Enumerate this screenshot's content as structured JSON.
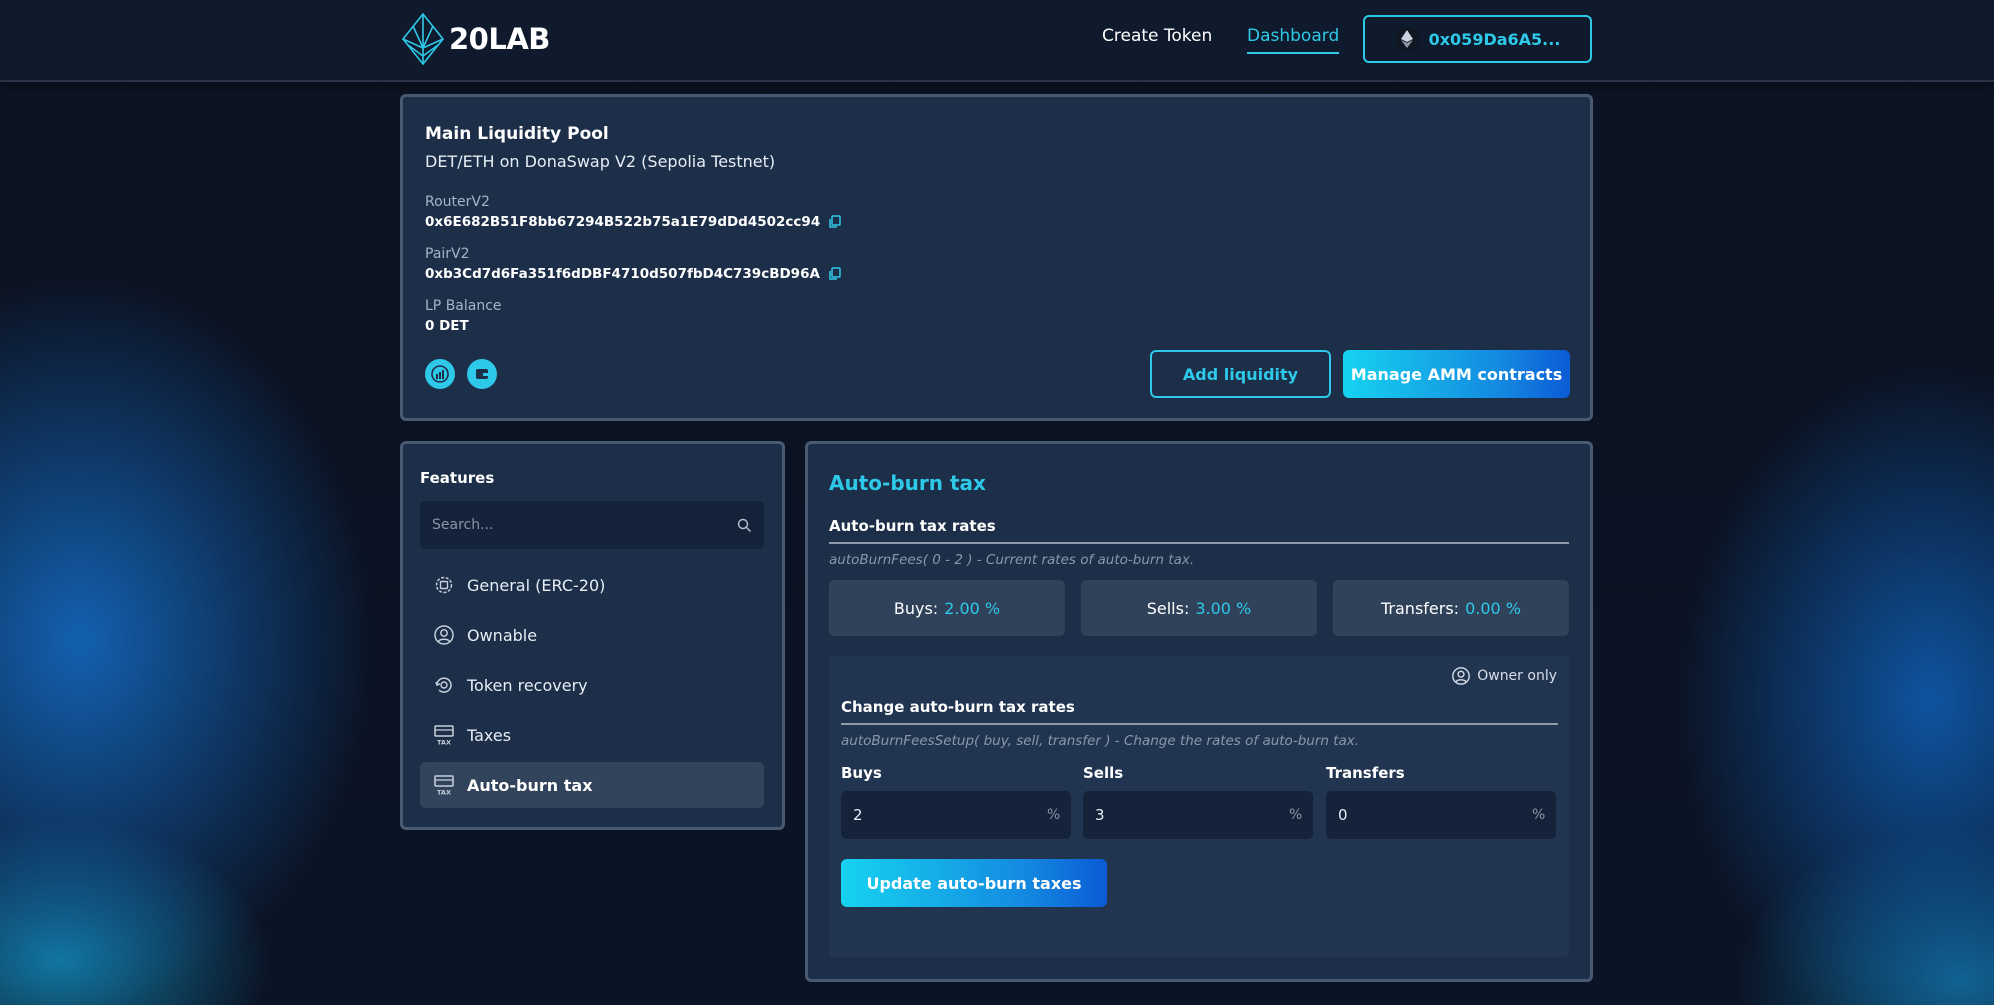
{
  "header": {
    "logo_text": "20LAB",
    "nav": {
      "create_token": "Create Token",
      "dashboard": "Dashboard"
    },
    "wallet_address": "0x059Da6A5..."
  },
  "pool": {
    "title": "Main Liquidity Pool",
    "subtitle": "DET/ETH on DonaSwap V2 (Sepolia Testnet)",
    "router_label": "RouterV2",
    "router_value": "0x6E682B51F8bb67294B522b75a1E79dDd4502cc94",
    "pair_label": "PairV2",
    "pair_value": "0xb3Cd7d6Fa351f6dDBF4710d507fbD4C739cBD96A",
    "lp_label": "LP Balance",
    "lp_value": "0 DET",
    "add_liquidity": "Add liquidity",
    "manage_amm": "Manage AMM contracts"
  },
  "features": {
    "title": "Features",
    "search_placeholder": "Search...",
    "items": [
      {
        "label": "General (ERC-20)",
        "icon": "gear-chip-icon"
      },
      {
        "label": "Ownable",
        "icon": "user-circle-icon"
      },
      {
        "label": "Token recovery",
        "icon": "recovery-icon"
      },
      {
        "label": "Taxes",
        "icon": "tax-icon"
      },
      {
        "label": "Auto-burn tax",
        "icon": "tax-icon"
      }
    ]
  },
  "autoburn": {
    "title": "Auto-burn tax",
    "rates_title": "Auto-burn tax rates",
    "rates_hint": "autoBurnFees( 0 - 2 ) - Current rates of auto-burn tax.",
    "buys_label": "Buys:",
    "buys_value": "2.00 %",
    "sells_label": "Sells:",
    "sells_value": "3.00 %",
    "transfers_label": "Transfers:",
    "transfers_value": "0.00 %",
    "owner_only": "Owner only",
    "change_title": "Change auto-burn tax rates",
    "change_hint": "autoBurnFeesSetup( buy, sell, transfer ) - Change the rates of auto-burn tax.",
    "input_buys_label": "Buys",
    "input_buys_value": "2",
    "input_sells_label": "Sells",
    "input_sells_value": "3",
    "input_transfers_label": "Transfers",
    "input_transfers_value": "0",
    "percent": "%",
    "update_button": "Update auto-burn taxes"
  }
}
